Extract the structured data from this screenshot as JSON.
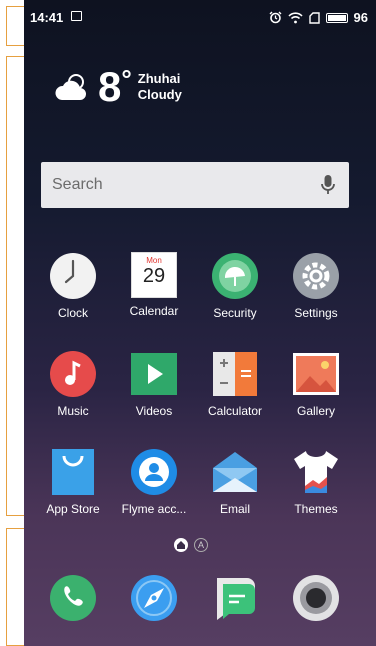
{
  "status": {
    "time": "14:41",
    "battery": "96"
  },
  "weather": {
    "temp": "8",
    "degree": "°",
    "city": "Zhuhai",
    "condition": "Cloudy"
  },
  "search": {
    "placeholder": "Search"
  },
  "calendar": {
    "month": "Mon",
    "day": "29"
  },
  "apps": [
    {
      "label": "Clock"
    },
    {
      "label": "Calendar"
    },
    {
      "label": "Security"
    },
    {
      "label": "Settings"
    },
    {
      "label": "Music"
    },
    {
      "label": "Videos"
    },
    {
      "label": "Calculator"
    },
    {
      "label": "Gallery"
    },
    {
      "label": "App Store"
    },
    {
      "label": "Flyme acc..."
    },
    {
      "label": "Email"
    },
    {
      "label": "Themes"
    }
  ],
  "page_indicator": {
    "auto": "A"
  }
}
